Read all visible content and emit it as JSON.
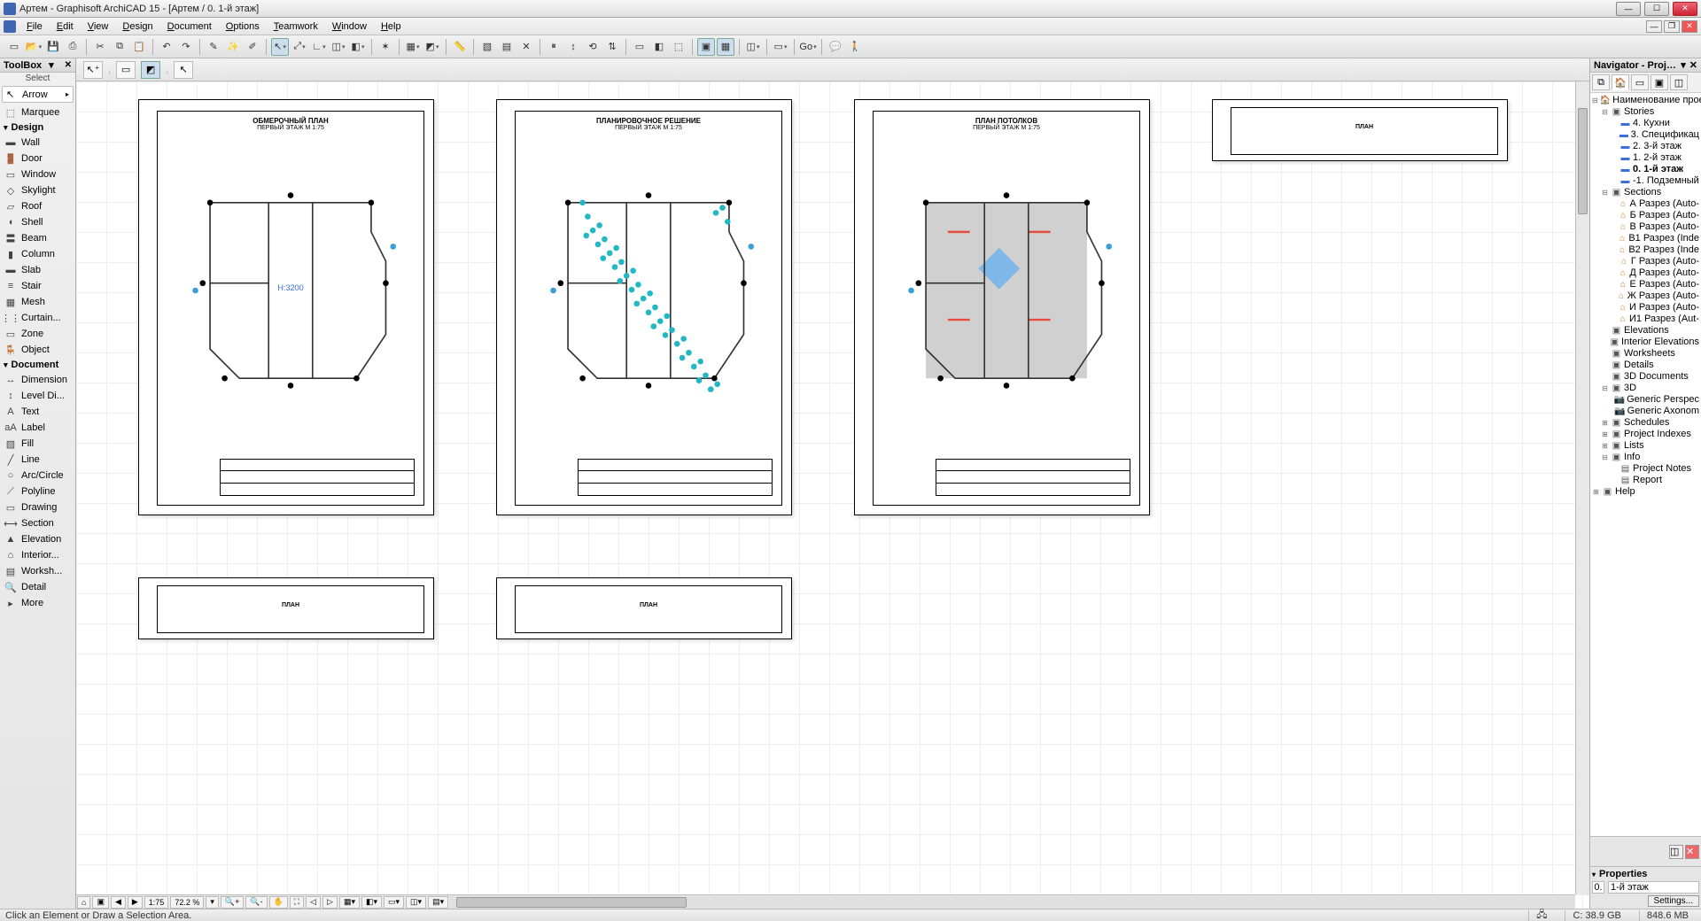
{
  "window": {
    "title": "Артем - Graphisoft ArchiCAD 15 - [Артем / 0. 1-й этаж]"
  },
  "menu": [
    "File",
    "Edit",
    "View",
    "Design",
    "Document",
    "Options",
    "Teamwork",
    "Window",
    "Help"
  ],
  "toolbox": {
    "title": "ToolBox",
    "select_label": "Select",
    "arrow": "Arrow",
    "marquee": "Marquee",
    "cat_design": "Design",
    "design": [
      "Wall",
      "Door",
      "Window",
      "Skylight",
      "Roof",
      "Shell",
      "Beam",
      "Column",
      "Slab",
      "Stair",
      "Mesh",
      "Curtain...",
      "Zone",
      "Object"
    ],
    "cat_document": "Document",
    "document": [
      "Dimension",
      "Level Di...",
      "Text",
      "Label",
      "Fill",
      "Line",
      "Arc/Circle",
      "Polyline",
      "Drawing",
      "Section",
      "Elevation",
      "Interior...",
      "Worksh...",
      "Detail"
    ],
    "more": "More"
  },
  "sheets": [
    {
      "title": "ОБМЕРОЧНЫЙ ПЛАН",
      "sub": "ПЕРВЫЙ ЭТАЖ М 1:75",
      "note": "H:3200",
      "type": "plan1"
    },
    {
      "title": "ПЛАНИРОВОЧНОЕ РЕШЕНИЕ",
      "sub": "ПЕРВЫЙ ЭТАЖ М 1:75",
      "type": "plan2"
    },
    {
      "title": "ПЛАН ПОТОЛКОВ",
      "sub": "ПЕРВЫЙ ЭТАЖ М 1:75",
      "type": "plan3"
    }
  ],
  "bottombar": {
    "scale": "1:75",
    "zoom": "72.2 %"
  },
  "navigator": {
    "title": "Navigator - Project ...",
    "root": "Наименование проекта",
    "stories_label": "Stories",
    "stories": [
      "4. Кухни",
      "3. Спецификац",
      "2. 3-й этаж",
      "1. 2-й этаж",
      "0. 1-й этаж",
      "-1. Подземный"
    ],
    "active_story_index": 4,
    "sections_label": "Sections",
    "sections": [
      "А Разрез (Auto-",
      "Б Разрез (Auto-",
      "В Разрез (Auto-",
      "В1 Разрез (Inde",
      "В2 Разрез (Inde",
      "Г Разрез (Auto-",
      "Д Разрез (Auto-",
      "Е Разрез (Auto-",
      "Ж Разрез (Auto-",
      "И Разрез (Auto-",
      "И1 Разрез (Aut-"
    ],
    "groups": [
      "Elevations",
      "Interior Elevations",
      "Worksheets",
      "Details",
      "3D Documents"
    ],
    "three_d": "3D",
    "three_d_items": [
      "Generic Perspec",
      "Generic Axonom"
    ],
    "schedules": "Schedules",
    "indexes": "Project Indexes",
    "lists": "Lists",
    "info": "Info",
    "info_items": [
      "Project Notes",
      "Report"
    ],
    "help": "Help",
    "properties": "Properties",
    "prop_value": "1-й этаж",
    "settings": "Settings..."
  },
  "status": {
    "hint": "Click an Element or Draw a Selection Area.",
    "disk": "C: 38.9 GB",
    "mem": "848.6 MB",
    "go": "Go"
  }
}
